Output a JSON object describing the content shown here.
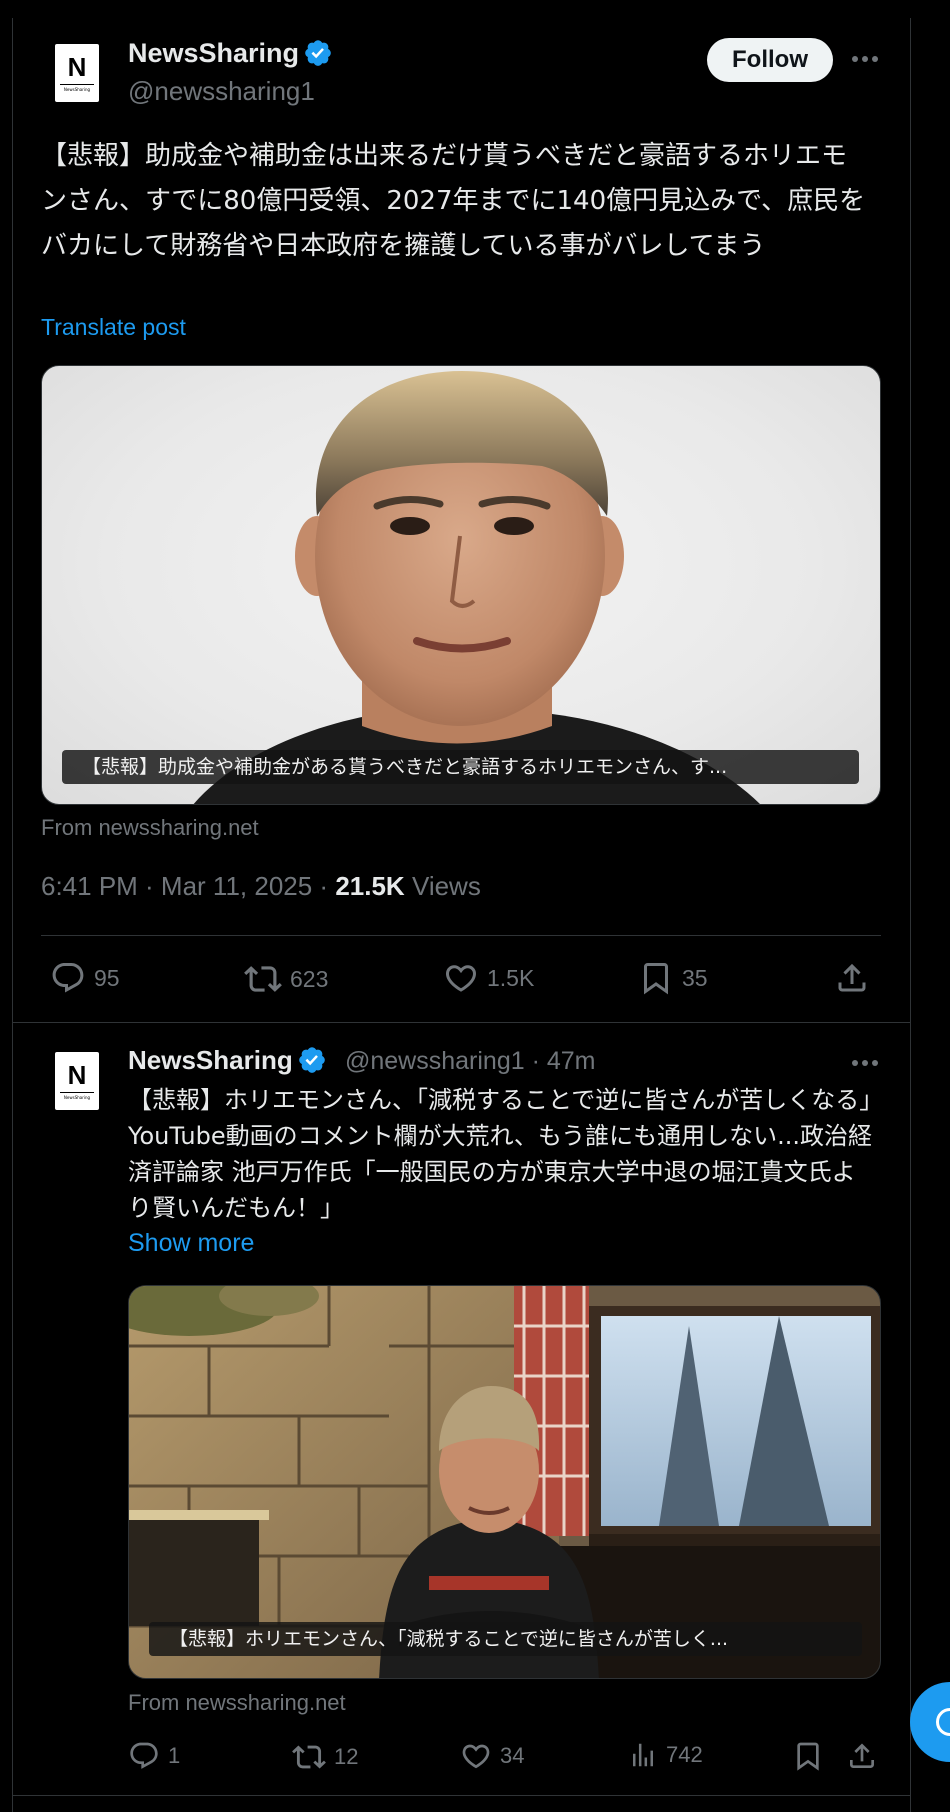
{
  "post": {
    "author_name": "NewsSharing",
    "author_handle": "@newssharing1",
    "avatar_letter": "N",
    "avatar_subtext": "NewsSharing",
    "follow_label": "Follow",
    "text": "【悲報】助成金や補助金は出来るだけ貰うべきだと豪語するホリエモンさん、すでに80億円受領、2027年までに140億円見込みで、庶民をバカにして財務省や日本政府を擁護している事がバレしてまう",
    "translate_label": "Translate post",
    "card_caption": "【悲報】助成金や補助金がある貰うべきだと豪語するホリエモンさん、す...",
    "card_source": "From newssharing.net",
    "time": "6:41 PM · Mar 11, 2025 · ",
    "views_count": "21.5K",
    "views_label": " Views",
    "stats": {
      "replies": "95",
      "reposts": "623",
      "likes": "1.5K",
      "bookmarks": "35"
    }
  },
  "reply": {
    "author_name": "NewsSharing",
    "author_handle": "@newssharing1 · 47m",
    "avatar_letter": "N",
    "avatar_subtext": "NewsSharing",
    "text": "【悲報】ホリエモンさん、「減税することで逆に皆さんが苦しくなる」YouTube動画のコメント欄が大荒れ、もう誰にも通用しない...政治経済評論家 池戸万作氏「一般国民の方が東京大学中退の堀江貴文氏より賢いんだもん！」",
    "show_more": "Show more",
    "card_caption": "【悲報】ホリエモンさん、「減税することで逆に皆さんが苦しく...",
    "card_source": "From newssharing.net",
    "stats": {
      "replies": "1",
      "reposts": "12",
      "likes": "34",
      "views": "742"
    }
  },
  "colors": {
    "background": "#000000",
    "text": "#e7e9ea",
    "muted": "#71767b",
    "accent": "#1d9bf0",
    "border": "#2f3336"
  },
  "icons": [
    "verified-badge-icon",
    "more-icon",
    "reply-icon",
    "repost-icon",
    "like-icon",
    "bookmark-icon",
    "share-icon",
    "views-icon"
  ]
}
